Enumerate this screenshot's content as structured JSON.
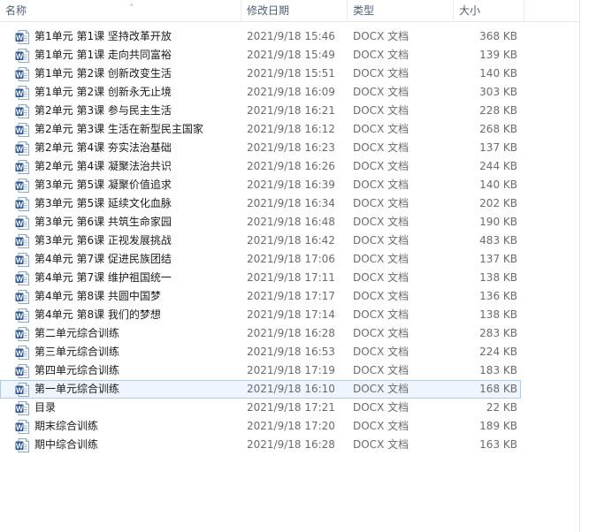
{
  "columns": {
    "name": "名称",
    "date": "修改日期",
    "type": "类型",
    "size": "大小"
  },
  "icon": "word-document-icon",
  "accent_color": "#2b579a",
  "selected_index": 19,
  "files": [
    {
      "name": "第1单元  第1课   坚持改革开放",
      "date": "2021/9/18 15:46",
      "type": "DOCX 文档",
      "size": "368 KB"
    },
    {
      "name": "第1单元  第1课   走向共同富裕",
      "date": "2021/9/18 15:49",
      "type": "DOCX 文档",
      "size": "139 KB"
    },
    {
      "name": "第1单元  第2课   创新改变生活",
      "date": "2021/9/18 15:51",
      "type": "DOCX 文档",
      "size": "140 KB"
    },
    {
      "name": "第1单元  第2课   创新永无止境",
      "date": "2021/9/18 16:09",
      "type": "DOCX 文档",
      "size": "303 KB"
    },
    {
      "name": "第2单元  第3课   参与民主生活",
      "date": "2021/9/18 16:21",
      "type": "DOCX 文档",
      "size": "228 KB"
    },
    {
      "name": "第2单元  第3课   生活在新型民主国家",
      "date": "2021/9/18 16:12",
      "type": "DOCX 文档",
      "size": "268 KB"
    },
    {
      "name": "第2单元  第4课   夯实法治基础",
      "date": "2021/9/18 16:23",
      "type": "DOCX 文档",
      "size": "137 KB"
    },
    {
      "name": "第2单元  第4课   凝聚法治共识",
      "date": "2021/9/18 16:26",
      "type": "DOCX 文档",
      "size": "244 KB"
    },
    {
      "name": "第3单元  第5课   凝聚价值追求",
      "date": "2021/9/18 16:39",
      "type": "DOCX 文档",
      "size": "140 KB"
    },
    {
      "name": "第3单元  第5课   延续文化血脉",
      "date": "2021/9/18 16:34",
      "type": "DOCX 文档",
      "size": "202 KB"
    },
    {
      "name": "第3单元  第6课   共筑生命家园",
      "date": "2021/9/18 16:48",
      "type": "DOCX 文档",
      "size": "190 KB"
    },
    {
      "name": "第3单元  第6课   正视发展挑战",
      "date": "2021/9/18 16:42",
      "type": "DOCX 文档",
      "size": "483 KB"
    },
    {
      "name": "第4单元  第7课   促进民族团结",
      "date": "2021/9/18 17:06",
      "type": "DOCX 文档",
      "size": "137 KB"
    },
    {
      "name": "第4单元  第7课   维护祖国统一",
      "date": "2021/9/18 17:11",
      "type": "DOCX 文档",
      "size": "138 KB"
    },
    {
      "name": "第4单元  第8课   共圆中国梦",
      "date": "2021/9/18 17:17",
      "type": "DOCX 文档",
      "size": "136 KB"
    },
    {
      "name": "第4单元  第8课   我们的梦想",
      "date": "2021/9/18 17:14",
      "type": "DOCX 文档",
      "size": "138 KB"
    },
    {
      "name": "第二单元综合训练",
      "date": "2021/9/18 16:28",
      "type": "DOCX 文档",
      "size": "283 KB"
    },
    {
      "name": "第三单元综合训练",
      "date": "2021/9/18 16:53",
      "type": "DOCX 文档",
      "size": "224 KB"
    },
    {
      "name": "第四单元综合训练",
      "date": "2021/9/18 17:19",
      "type": "DOCX 文档",
      "size": "183 KB"
    },
    {
      "name": "第一单元综合训练",
      "date": "2021/9/18 16:10",
      "type": "DOCX 文档",
      "size": "168 KB"
    },
    {
      "name": "目录",
      "date": "2021/9/18 17:21",
      "type": "DOCX 文档",
      "size": "22 KB"
    },
    {
      "name": "期末综合训练",
      "date": "2021/9/18 17:20",
      "type": "DOCX 文档",
      "size": "189 KB"
    },
    {
      "name": "期中综合训练",
      "date": "2021/9/18 16:28",
      "type": "DOCX 文档",
      "size": "163 KB"
    }
  ]
}
